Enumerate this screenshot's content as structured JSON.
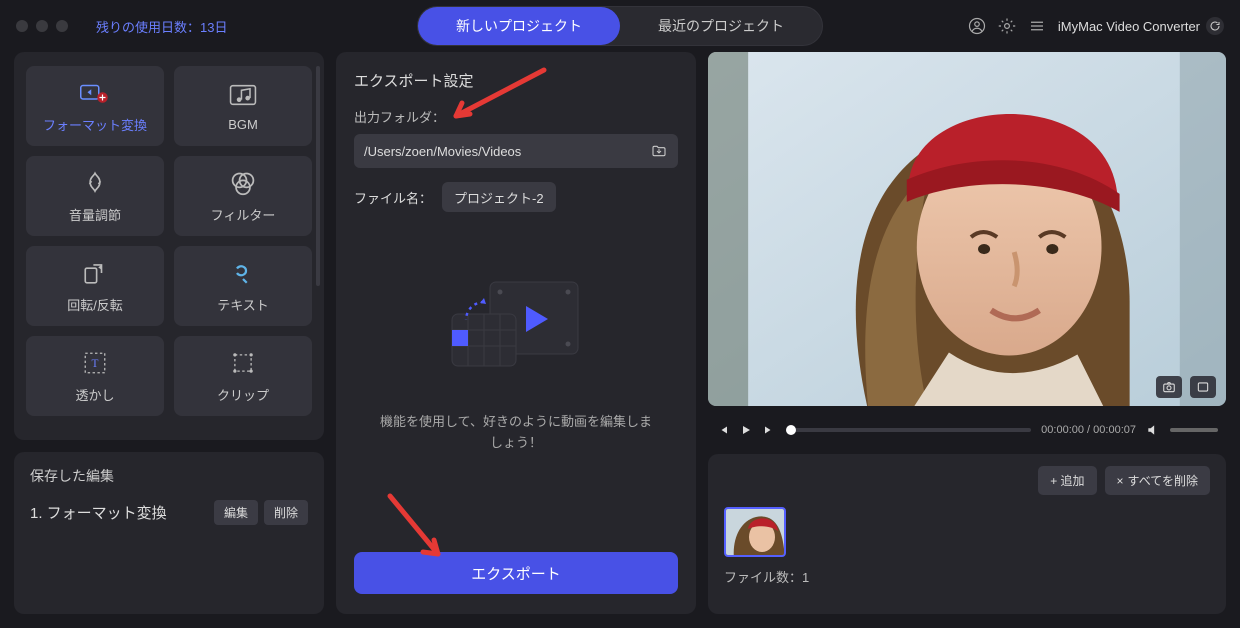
{
  "header": {
    "trial_text": "残りの使用日数：13日",
    "tab_new": "新しいプロジェクト",
    "tab_recent": "最近のプロジェクト",
    "app_name": "iMyMac Video Converter"
  },
  "tools": {
    "items": [
      {
        "label": "フォーマット変換",
        "icon": "convert",
        "active": true
      },
      {
        "label": "BGM",
        "icon": "bgm"
      },
      {
        "label": "音量調節",
        "icon": "volume"
      },
      {
        "label": "フィルター",
        "icon": "filter"
      },
      {
        "label": "回転/反転",
        "icon": "rotate"
      },
      {
        "label": "テキスト",
        "icon": "text"
      },
      {
        "label": "透かし",
        "icon": "watermark"
      },
      {
        "label": "クリップ",
        "icon": "crop"
      }
    ]
  },
  "saved": {
    "title": "保存した編集",
    "item": "1.  フォーマット変換",
    "edit": "編集",
    "delete": "削除"
  },
  "export": {
    "title": "エクスポート設定",
    "folder_label": "出力フォルダ：",
    "folder_path": "/Users/zoen/Movies/Videos",
    "filename_label": "ファイル名：",
    "filename_value": "プロジェクト-2",
    "caption": "機能を使用して、好きのように動画を編集しましょう！",
    "button": "エクスポート"
  },
  "player": {
    "time_current": "00:00:00",
    "time_total": "00:00:07"
  },
  "files": {
    "add": "+ 追加",
    "delete_all": "すべてを削除",
    "delete_icon": "×",
    "count_label": "ファイル数：1"
  }
}
